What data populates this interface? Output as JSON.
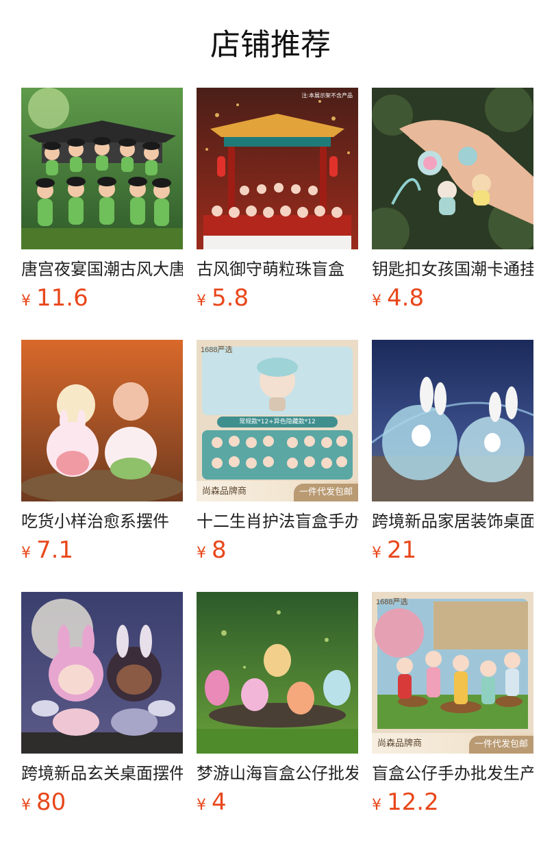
{
  "page": {
    "title": "店铺推荐"
  },
  "products": [
    {
      "name": "唐宫夜宴国潮古风大唐",
      "currency": "¥",
      "price": "11.6",
      "image": "tang-palace-figurines"
    },
    {
      "name": "古风御守萌粒珠盲盒",
      "currency": "¥",
      "price": "5.8",
      "image": "pavilion-figurine-set",
      "note": "注:本展示架不含产品"
    },
    {
      "name": "钥匙扣女孩国潮卡通挂",
      "currency": "¥",
      "price": "4.8",
      "image": "keychain-hand"
    },
    {
      "name": "吃货小样治愈系摆件",
      "currency": "¥",
      "price": "7.1",
      "image": "foodie-animal-figurines"
    },
    {
      "name": "十二生肖护法盲盒手办",
      "currency": "¥",
      "price": "8",
      "image": "zodiac-blind-box",
      "badge": "1688严选",
      "banner": "常规款*12+异色隐藏款*12",
      "band_left": "尚森品牌商",
      "band_right": "一件代发包邮"
    },
    {
      "name": "跨境新品家居装饰桌面",
      "currency": "¥",
      "price": "21",
      "image": "crystal-bunny-globes"
    },
    {
      "name": "跨境新品玄关桌面摆件",
      "currency": "¥",
      "price": "80",
      "image": "angel-bunny-girls"
    },
    {
      "name": "梦游山海盲盒公仔批发",
      "currency": "¥",
      "price": "4",
      "image": "mountain-sea-creatures"
    },
    {
      "name": "盲盒公仔手办批发生产",
      "currency": "¥",
      "price": "12.2",
      "image": "hanfu-girls-palace",
      "badge": "1688严选",
      "band_left": "尚森品牌商",
      "band_right": "一件代发包邮"
    }
  ]
}
